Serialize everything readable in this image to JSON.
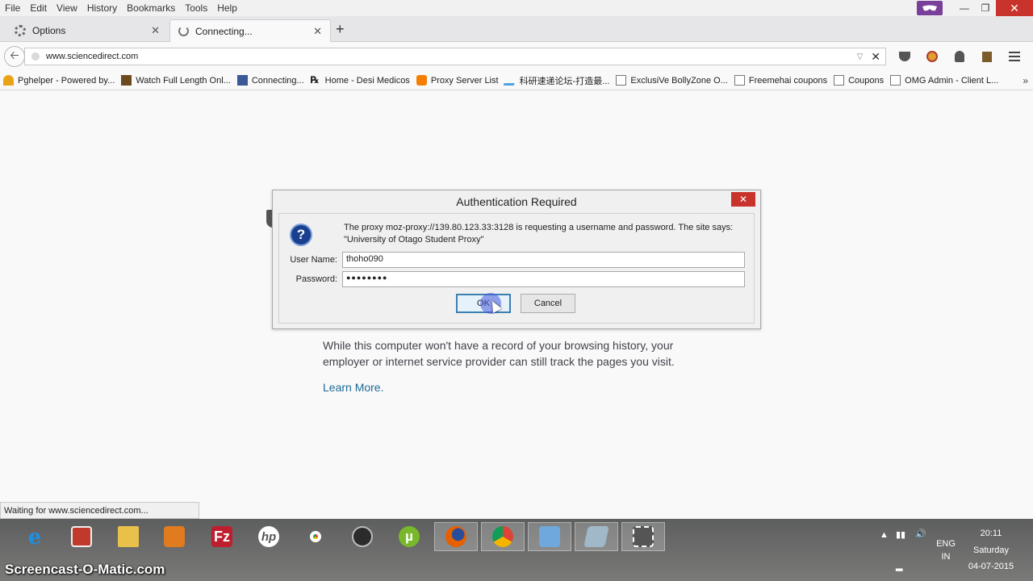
{
  "menubar": {
    "items": [
      "File",
      "Edit",
      "View",
      "History",
      "Bookmarks",
      "Tools",
      "Help"
    ]
  },
  "tabs": [
    {
      "label": "Options",
      "icon": "gear-icon"
    },
    {
      "label": "Connecting...",
      "icon": "spinner-icon"
    }
  ],
  "navbar": {
    "url": "www.sciencedirect.com"
  },
  "bookmarks": [
    {
      "label": "Pghelper - Powered by...",
      "color": "#e8a317"
    },
    {
      "label": "Watch Full Length Onl...",
      "color": "#6b4a1e"
    },
    {
      "label": "Connecting...",
      "color": "#3b5998"
    },
    {
      "label": "Home - Desi Medicos",
      "color": "#333333"
    },
    {
      "label": "Proxy Server List",
      "color": "#f57d00"
    },
    {
      "label": "科研速递论坛-打造最...",
      "color": "#4da3e0"
    },
    {
      "label": "ExclusiVe BollyZone O...",
      "color": "#ffffff"
    },
    {
      "label": "Freemehai coupons",
      "color": "#ffffff"
    },
    {
      "label": "Coupons",
      "color": "#ffffff"
    },
    {
      "label": "OMG Admin - Client L...",
      "color": "#ffffff"
    }
  ],
  "content": {
    "private_text": "While this computer won't have a record of your browsing history, your employer or internet service provider can still track the pages you visit.",
    "learn_more": "Learn More."
  },
  "dialog": {
    "title": "Authentication Required",
    "message_line1": "The proxy moz-proxy://139.80.123.33:3128 is requesting a username and password. The site says:",
    "message_line2": "\"University of Otago Student Proxy\"",
    "username_label": "User Name:",
    "username_value": "thoho090",
    "password_label": "Password:",
    "password_value": "●●●●●●●●",
    "ok_label": "OK",
    "cancel_label": "Cancel"
  },
  "statusbar": {
    "text": "Waiting for www.sciencedirect.com..."
  },
  "taskbar": {
    "apps": [
      {
        "name": "internet-explorer-icon",
        "color": "#1e90e0"
      },
      {
        "name": "flash-icon",
        "color": "#c0392b"
      },
      {
        "name": "file-explorer-icon",
        "color": "#e8c04a"
      },
      {
        "name": "media-player-icon",
        "color": "#e07b20"
      },
      {
        "name": "filezilla-icon",
        "color": "#bf1e2e"
      },
      {
        "name": "hp-icon",
        "color": "#ffffff"
      },
      {
        "name": "chrome-icon",
        "color": "#4caf50"
      },
      {
        "name": "media-app-icon",
        "color": "#333333"
      },
      {
        "name": "utorrent-icon",
        "color": "#78b82a"
      },
      {
        "name": "firefox-icon",
        "color": "#e66000"
      },
      {
        "name": "chrome-app-icon",
        "color": "#db4437"
      },
      {
        "name": "control-panel-icon",
        "color": "#6fa8dc"
      },
      {
        "name": "notes-icon",
        "color": "#9fb9c9"
      },
      {
        "name": "snipping-tool-icon",
        "color": "#555555"
      }
    ],
    "lang": "ENG",
    "region": "IN",
    "time": "20:11",
    "day": "Saturday",
    "date": "04-07-2015"
  },
  "watermark": "Screencast-O-Matic.com"
}
